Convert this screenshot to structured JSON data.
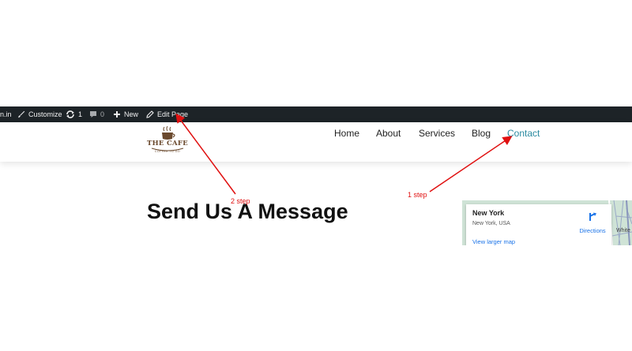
{
  "adminbar": {
    "site_fragment": "n.in",
    "customize": "Customize",
    "updates_count": "1",
    "comments_count": "0",
    "new": "New",
    "edit_page": "Edit Page"
  },
  "logo": {
    "title": "THE CAFE",
    "tagline": "COFFEE TO GO"
  },
  "nav": {
    "items": [
      "Home",
      "About",
      "Services",
      "Blog",
      "Contact"
    ],
    "active": "Contact",
    "active_color": "#2a8aa0"
  },
  "main": {
    "heading": "Send Us A Message"
  },
  "map": {
    "place_name": "New York",
    "place_sub": "New York, USA",
    "directions": "Directions",
    "view_larger": "View larger map",
    "edge_label": "White"
  },
  "annotations": {
    "step1": "1 step",
    "step2": "2 step",
    "color": "#e01010"
  },
  "icons": {
    "customize": "brush-icon",
    "updates": "refresh-icon",
    "comments": "comment-icon",
    "new": "plus-icon",
    "edit": "pencil-icon",
    "directions": "directions-icon",
    "logo": "coffee-cup-icon"
  }
}
